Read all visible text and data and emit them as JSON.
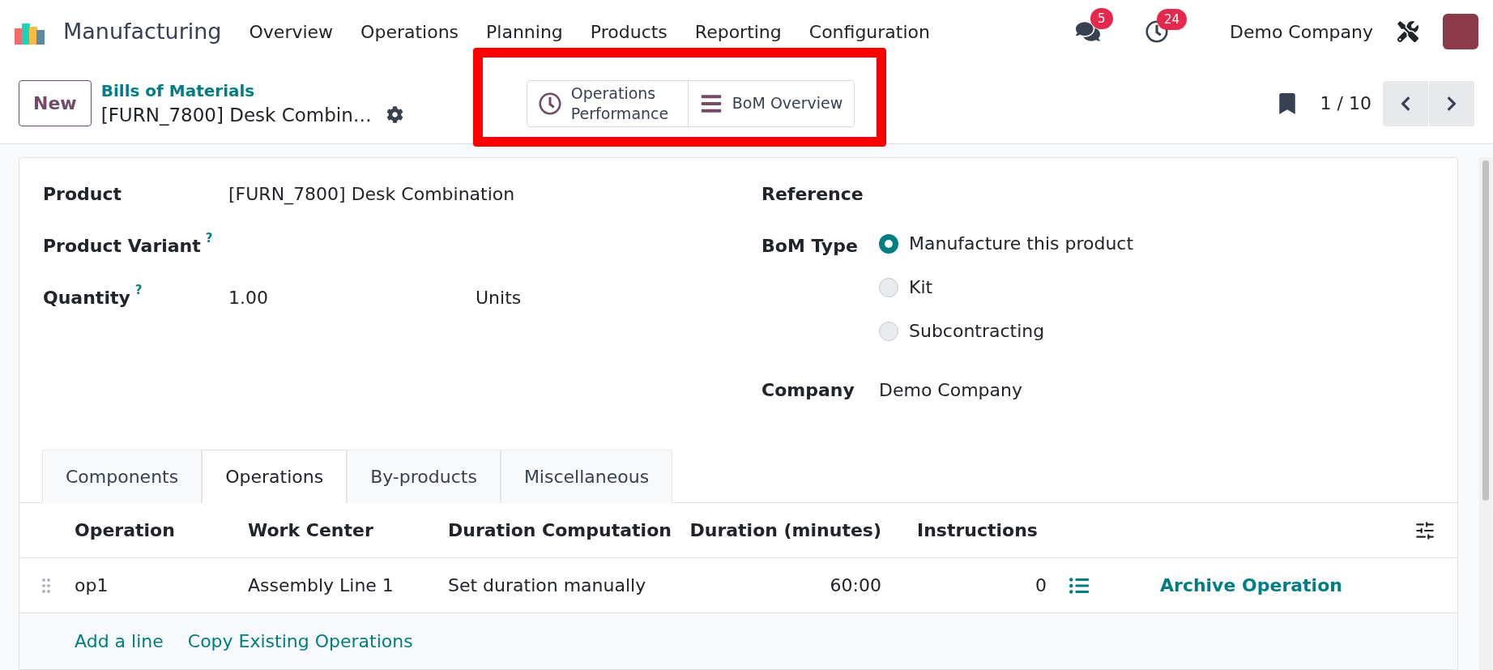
{
  "app": {
    "name": "Manufacturing"
  },
  "menu": [
    {
      "label": "Overview"
    },
    {
      "label": "Operations"
    },
    {
      "label": "Planning"
    },
    {
      "label": "Products"
    },
    {
      "label": "Reporting"
    },
    {
      "label": "Configuration"
    }
  ],
  "systray": {
    "messages_count": "5",
    "activities_count": "24",
    "company": "Demo Company"
  },
  "control_panel": {
    "new_button": "New",
    "breadcrumb": "Bills of Materials",
    "record_title": "[FURN_7800] Desk Combin…",
    "smart_buttons": [
      {
        "kind": "clock",
        "label": "Operations Performance"
      },
      {
        "kind": "bars",
        "label": "BoM Overview"
      }
    ],
    "highlighted": true,
    "pager": "1 / 10"
  },
  "form": {
    "left_fields": [
      {
        "label": "Product",
        "value": "[FURN_7800] Desk Combination"
      },
      {
        "label": "Product Variant",
        "help": "?"
      },
      {
        "label": "Quantity",
        "help": "?",
        "value": "1.00",
        "unit": "Units"
      }
    ],
    "reference": {
      "label": "Reference"
    },
    "bom_type": {
      "label": "BoM Type",
      "options": [
        {
          "label": "Manufacture this product",
          "selected": true
        },
        {
          "label": "Kit",
          "selected": false
        },
        {
          "label": "Subcontracting",
          "selected": false
        }
      ]
    },
    "company": {
      "label": "Company",
      "value": "Demo Company"
    }
  },
  "tabs": [
    {
      "label": "Components",
      "selected": false
    },
    {
      "label": "Operations",
      "selected": true
    },
    {
      "label": "By-products",
      "selected": false
    },
    {
      "label": "Miscellaneous",
      "selected": false
    }
  ],
  "table": {
    "columns": [
      "Operation",
      "Work Center",
      "Duration Computation",
      "Duration (minutes)",
      "Instructions"
    ],
    "rows": [
      {
        "operation": "op1",
        "work_center": "Assembly Line 1",
        "duration_computation": "Set duration manually",
        "duration": "60:00",
        "instructions": "0",
        "action": "Archive Operation"
      }
    ],
    "footer_links": [
      "Add a line",
      "Copy Existing Operations"
    ]
  }
}
